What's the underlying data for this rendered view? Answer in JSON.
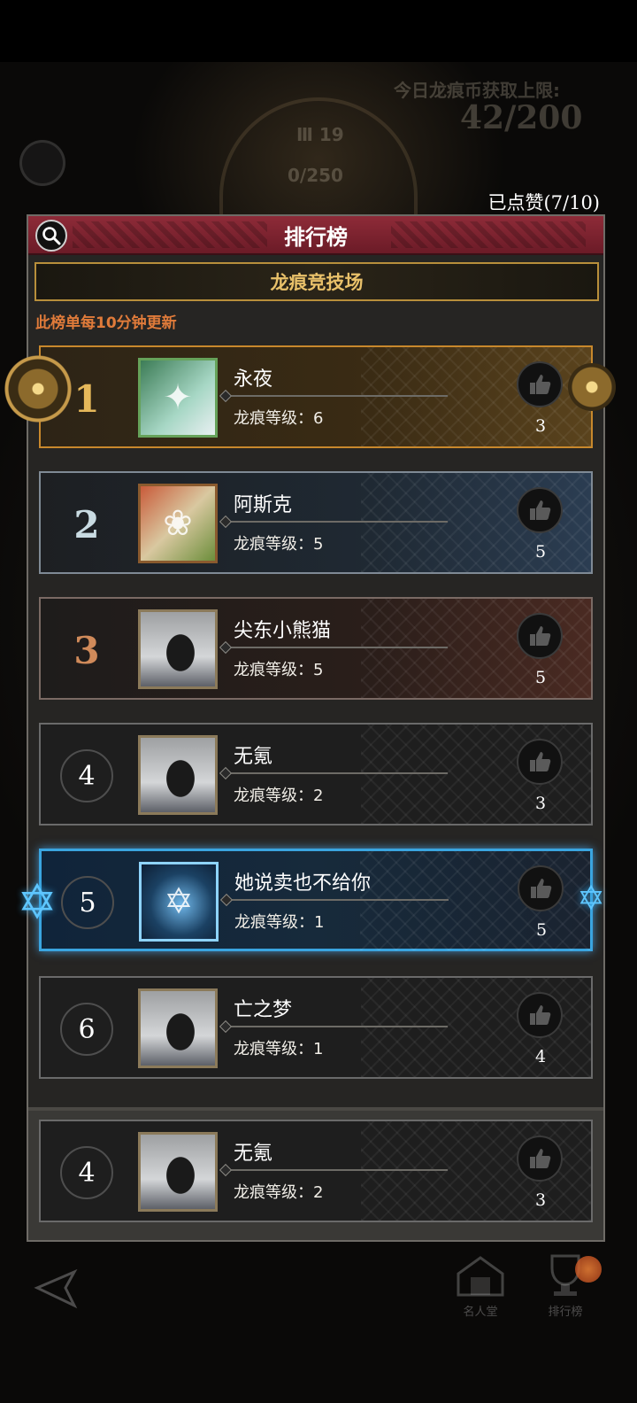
{
  "background": {
    "quota_label": "今日龙痕币获取上限:",
    "quota_value": "42/200",
    "emblem_level": "Ⅲ 19",
    "emblem_progress": "0/250"
  },
  "likes_counter": "已点赞(7/10)",
  "panel": {
    "title": "排行榜",
    "subtab": "龙痕竞技场",
    "notice": "此榜单每10分钟更新"
  },
  "rows": [
    {
      "rank": "1",
      "name": "永夜",
      "level": "龙痕等级：6",
      "likes": "3"
    },
    {
      "rank": "2",
      "name": "阿斯克",
      "level": "龙痕等级：5",
      "likes": "5"
    },
    {
      "rank": "3",
      "name": "尖东小熊猫",
      "level": "龙痕等级：5",
      "likes": "5"
    },
    {
      "rank": "4",
      "name": "无氪",
      "level": "龙痕等级：2",
      "likes": "3"
    },
    {
      "rank": "5",
      "name": "她说卖也不给你",
      "level": "龙痕等级：1",
      "likes": "5"
    },
    {
      "rank": "6",
      "name": "亡之梦",
      "level": "龙痕等级：1",
      "likes": "4"
    }
  ],
  "my_row": {
    "rank": "4",
    "name": "无氪",
    "level": "龙痕等级：2",
    "likes": "3"
  },
  "bottom_nav": {
    "hall_label": "名人堂",
    "trophy_label": "排行榜"
  },
  "colors": {
    "header_red": "#8e2b38",
    "gold": "#e6b85a",
    "notice_orange": "#e07b3a",
    "highlight_blue": "#3aa5e0"
  }
}
